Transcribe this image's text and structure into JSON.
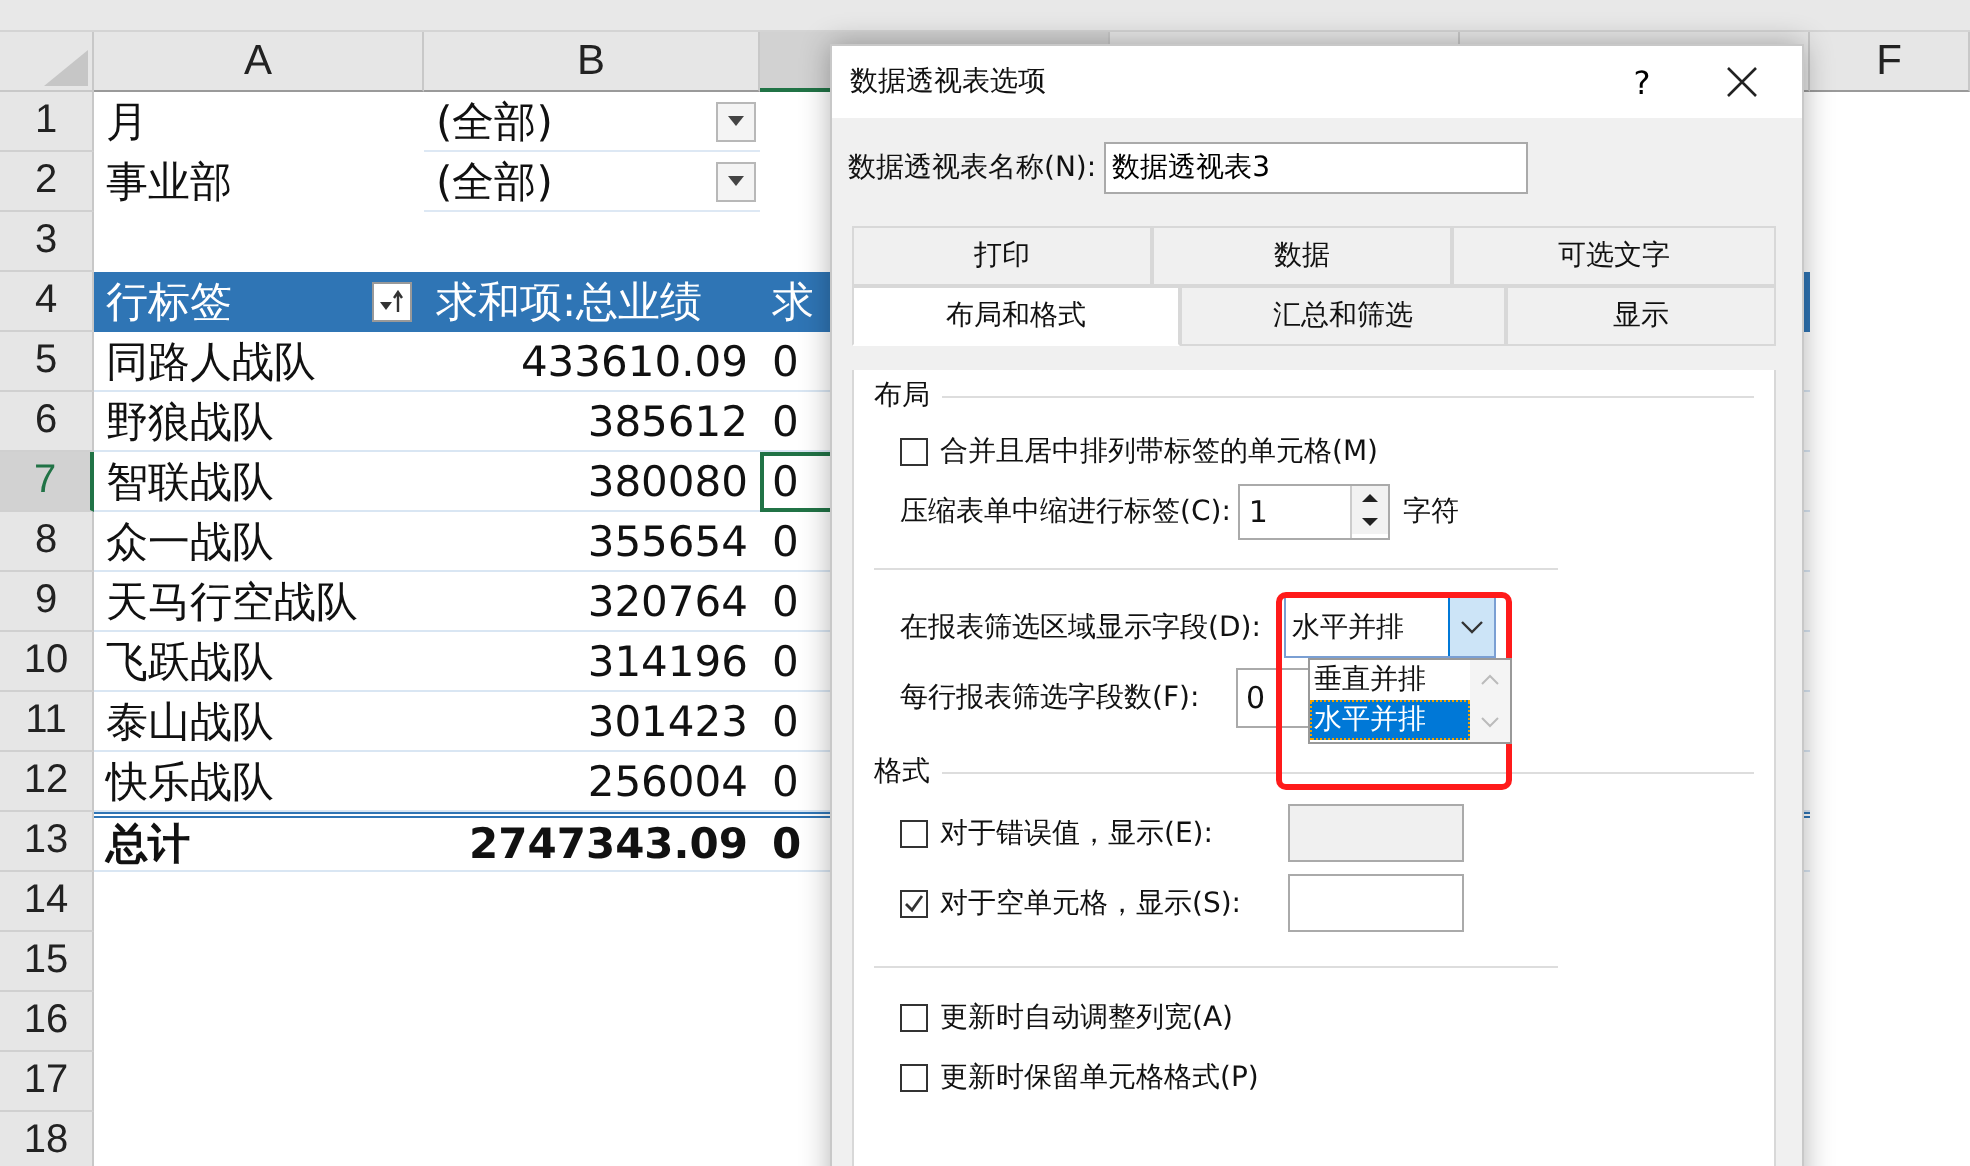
{
  "sheet": {
    "columns": [
      {
        "label": "A",
        "selected": false
      },
      {
        "label": "B",
        "selected": false
      },
      {
        "selected": true
      },
      {
        "selected": false
      },
      {
        "selected": false
      },
      {
        "label": "F",
        "selected": false
      }
    ],
    "rows": [
      {
        "number": "1",
        "kind": "filter",
        "field": "月",
        "value": "(全部)",
        "selected": false
      },
      {
        "number": "2",
        "kind": "filter",
        "field": "事业部",
        "value": "(全部)",
        "selected": false
      },
      {
        "number": "3",
        "kind": "blank",
        "selected": false
      },
      {
        "number": "4",
        "kind": "header",
        "label": "行标签",
        "value": "求和项:总业绩",
        "column_3": "求",
        "selected": false
      },
      {
        "number": "5",
        "kind": "data",
        "label": "同路人战队",
        "value": "433610.09",
        "column_3": "0",
        "selected": false
      },
      {
        "number": "6",
        "kind": "data",
        "label": "野狼战队",
        "value": "385612",
        "column_3": "0",
        "selected": false
      },
      {
        "number": "7",
        "kind": "data",
        "label": "智联战队",
        "value": "380080",
        "column_3": "0",
        "selected": true
      },
      {
        "number": "8",
        "kind": "data",
        "label": "众一战队",
        "value": "355654",
        "column_3": "0",
        "selected": false
      },
      {
        "number": "9",
        "kind": "data",
        "label": "天马行空战队",
        "value": "320764",
        "column_3": "0",
        "selected": false
      },
      {
        "number": "10",
        "kind": "data",
        "label": "飞跃战队",
        "value": "314196",
        "column_3": "0",
        "selected": false
      },
      {
        "number": "11",
        "kind": "data",
        "label": "泰山战队",
        "value": "301423",
        "column_3": "0",
        "selected": false
      },
      {
        "number": "12",
        "kind": "data",
        "label": "快乐战队",
        "value": "256004",
        "column_3": "0",
        "selected": false
      },
      {
        "number": "13",
        "kind": "total",
        "label": "总计",
        "value": "2747343.09",
        "column_3": "0",
        "selected": false
      },
      {
        "number": "14",
        "kind": "blank",
        "selected": false
      },
      {
        "number": "15",
        "kind": "blank",
        "selected": false
      },
      {
        "number": "16",
        "kind": "blank",
        "selected": false
      },
      {
        "number": "17",
        "kind": "blank",
        "selected": false
      },
      {
        "number": "18",
        "kind": "blank",
        "selected": false
      }
    ]
  },
  "dialog": {
    "title": "数据透视表选项",
    "help": "?",
    "name_label": "数据透视表名称(N):",
    "name_value": "数据透视表3",
    "tab_rows": [
      [
        {
          "label": "打印",
          "selected": false
        },
        {
          "label": "数据",
          "selected": false
        },
        {
          "label": "可选文字",
          "selected": false
        }
      ],
      [
        {
          "label": "布局和格式",
          "selected": true
        },
        {
          "label": "汇总和筛选",
          "selected": false
        },
        {
          "label": "显示",
          "selected": false
        }
      ]
    ],
    "layout": {
      "title": "布局",
      "merge": {
        "label": "合并且居中排列带标签的单元格(M)",
        "checked": false
      },
      "indent": {
        "label": "压缩表单中缩进行标签(C):",
        "value": "1",
        "unit": "字符"
      },
      "filter_display": {
        "label": "在报表筛选区域显示字段(D):",
        "value": "水平并排",
        "expanded": true,
        "options": [
          {
            "label": "垂直并排",
            "selected": false
          },
          {
            "label": "水平并排",
            "selected": true
          }
        ]
      },
      "fields_per_row": {
        "label": "每行报表筛选字段数(F):",
        "value": "0"
      }
    },
    "format": {
      "title": "格式",
      "error": {
        "label": "对于错误值，显示(E):",
        "checked": false
      },
      "empty": {
        "label": "对于空单元格，显示(S):",
        "checked": true
      }
    },
    "options": [
      {
        "label": "更新时自动调整列宽(A)",
        "checked": false
      },
      {
        "label": "更新时保留单元格格式(P)",
        "checked": false
      }
    ]
  }
}
